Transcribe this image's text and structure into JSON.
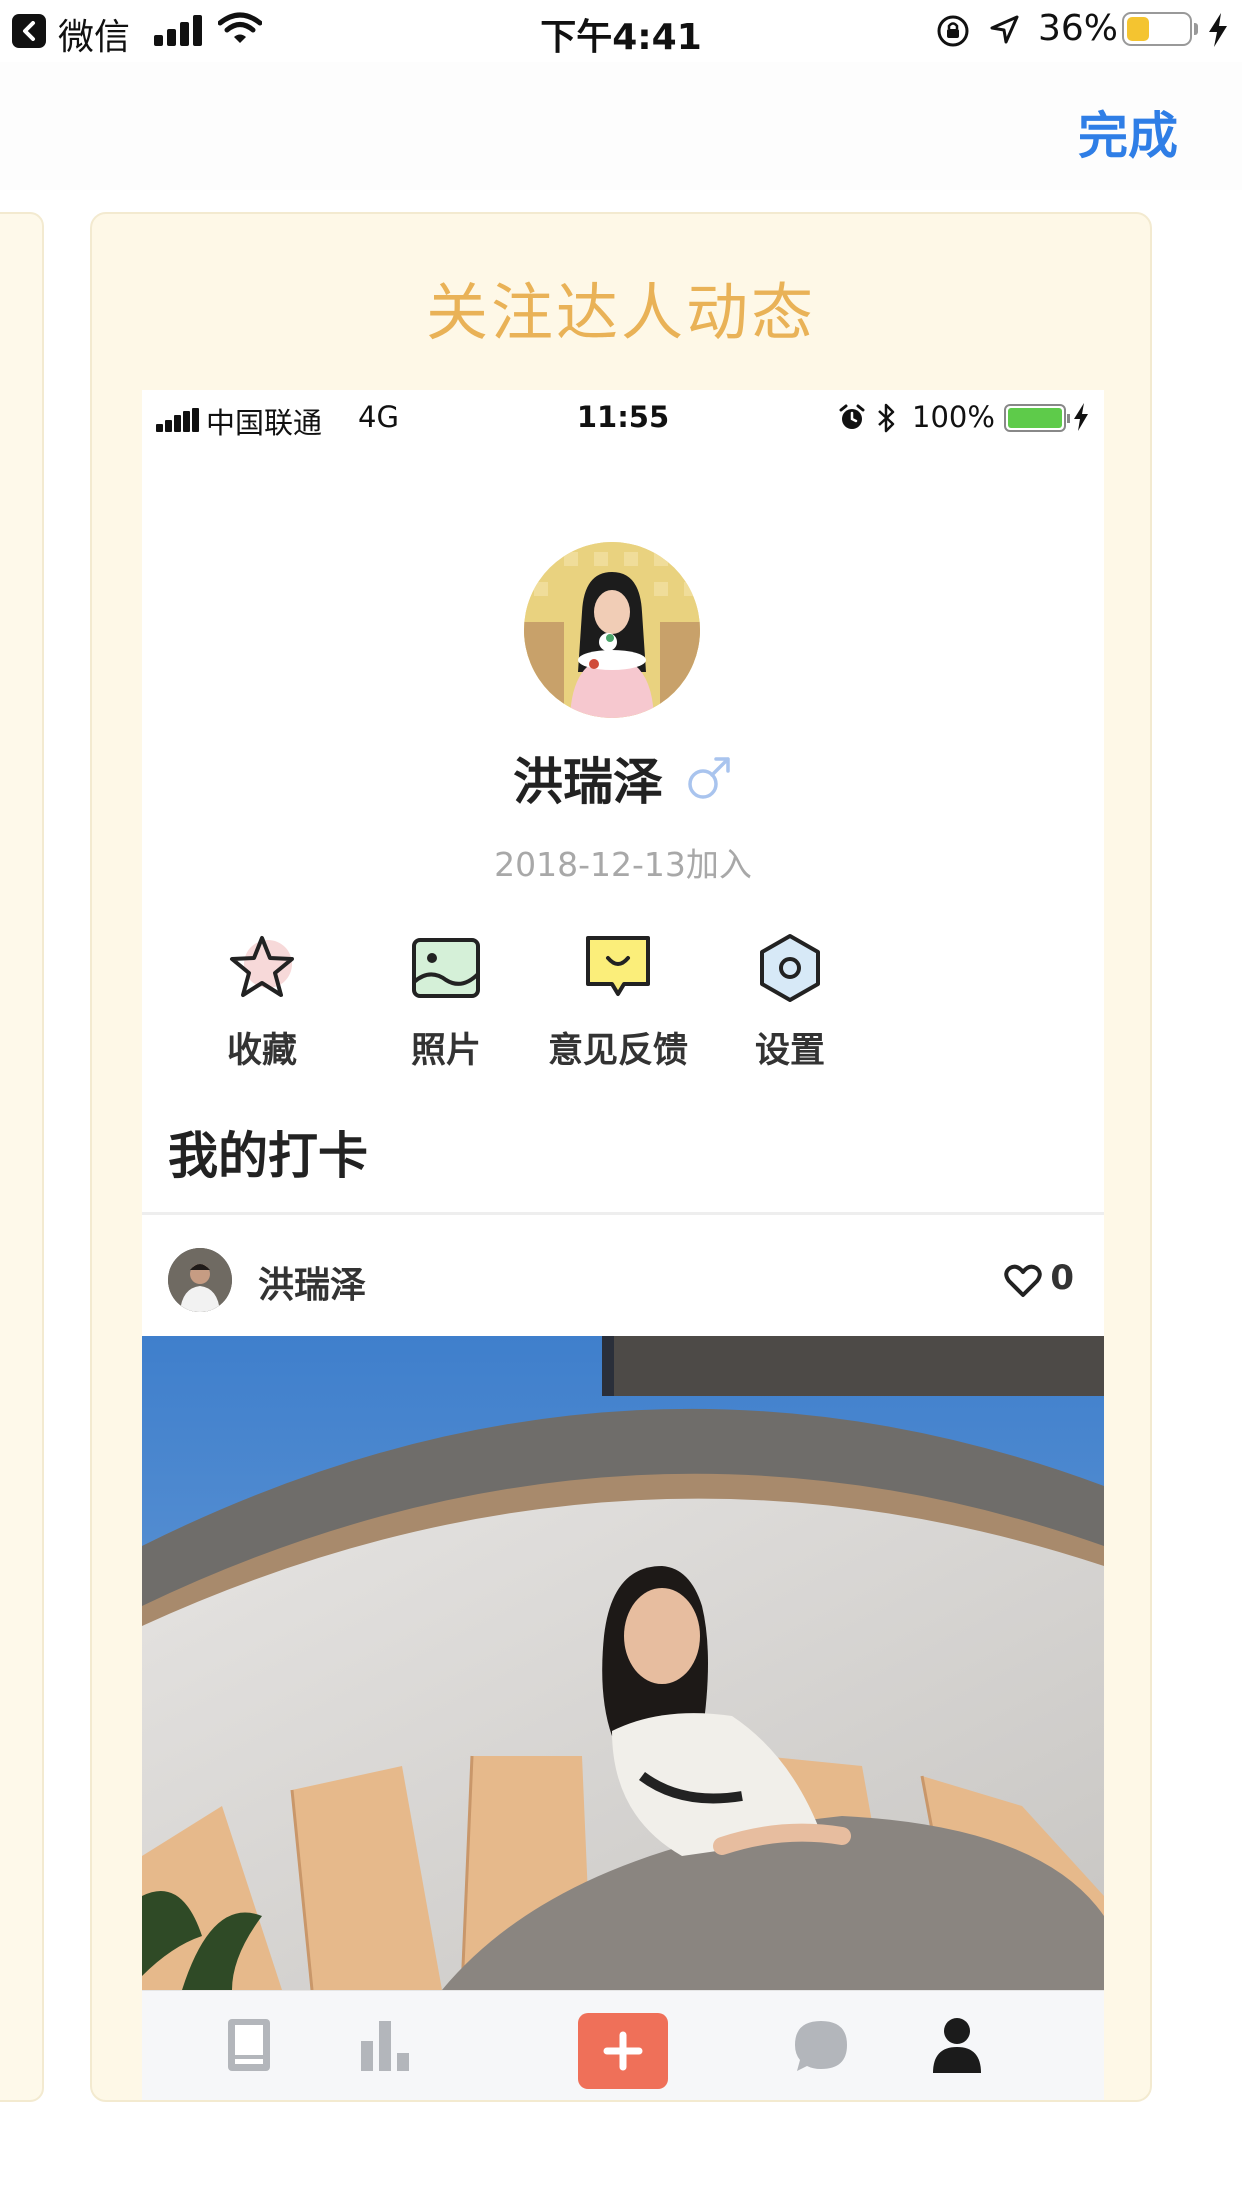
{
  "status_bar": {
    "back_app": "微信",
    "time": "下午4:41",
    "battery_percent": "36%",
    "battery_level": 0.36,
    "battery_color": "#f4c430"
  },
  "nav": {
    "done_label": "完成",
    "done_color": "#2f7ee6"
  },
  "card": {
    "title": "关注达人动态",
    "title_color": "#e9b257",
    "background": "#fef8e7"
  },
  "phone": {
    "status_bar": {
      "carrier": "中国联通",
      "network": "4G",
      "time": "11:55",
      "battery_percent": "100%",
      "battery_level": 1.0
    },
    "profile": {
      "name": "洪瑞泽",
      "gender_icon": "male-symbol-icon",
      "joined": "2018-12-13加入"
    },
    "actions": [
      {
        "label": "收藏",
        "icon": "star-icon"
      },
      {
        "label": "照片",
        "icon": "photo-icon"
      },
      {
        "label": "意见反馈",
        "icon": "feedback-icon"
      },
      {
        "label": "设置",
        "icon": "settings-hexagon-icon"
      }
    ],
    "section_title": "我的打卡",
    "post": {
      "author": "洪瑞泽",
      "likes": "0"
    },
    "tabs": [
      {
        "name": "book-icon"
      },
      {
        "name": "bar-chart-icon"
      },
      {
        "name": "add-icon",
        "color": "#ef7059"
      },
      {
        "name": "chat-bubble-icon"
      },
      {
        "name": "person-icon",
        "active": true
      }
    ]
  }
}
